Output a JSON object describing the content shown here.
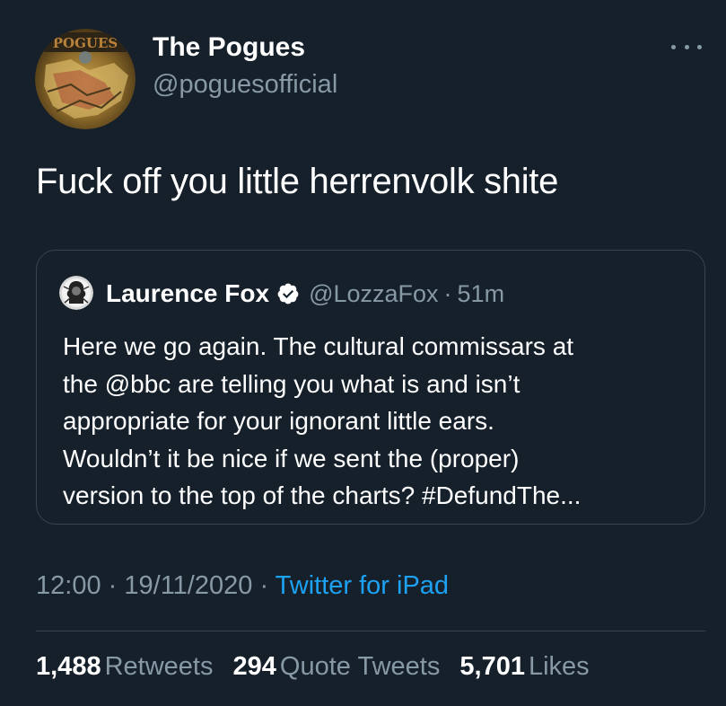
{
  "tweet": {
    "author": {
      "name": "The Pogues",
      "handle": "@poguesofficial",
      "avatar_text": "POGUES"
    },
    "text": "Fuck off you little herrenvolk shite",
    "quoted_tweet": {
      "author_name": "Laurence Fox",
      "handle": "@LozzaFox",
      "separator": "·",
      "time_ago": "51m",
      "verified": true,
      "text_lines": [
        "Here we go again. The cultural commissars at",
        "the @bbc are telling you what is and isn’t",
        "appropriate for your ignorant little ears.",
        "Wouldn’t it be nice if we sent the (proper)",
        "version to the top of the charts? #DefundThe..."
      ]
    },
    "meta": {
      "time": "12:00",
      "separator": "·",
      "date": "19/11/2020",
      "source": "Twitter for iPad"
    },
    "stats": {
      "retweets_count": "1,488",
      "retweets_label": "Retweets",
      "quotes_count": "294",
      "quotes_label": "Quote Tweets",
      "likes_count": "5,701",
      "likes_label": "Likes"
    }
  },
  "colors": {
    "background": "#15202b",
    "secondary_text": "#8899a6",
    "link": "#1da1f2",
    "border": "#38444d"
  },
  "icons": {
    "more": "more-horizontal-icon",
    "verified": "verified-badge-icon"
  }
}
